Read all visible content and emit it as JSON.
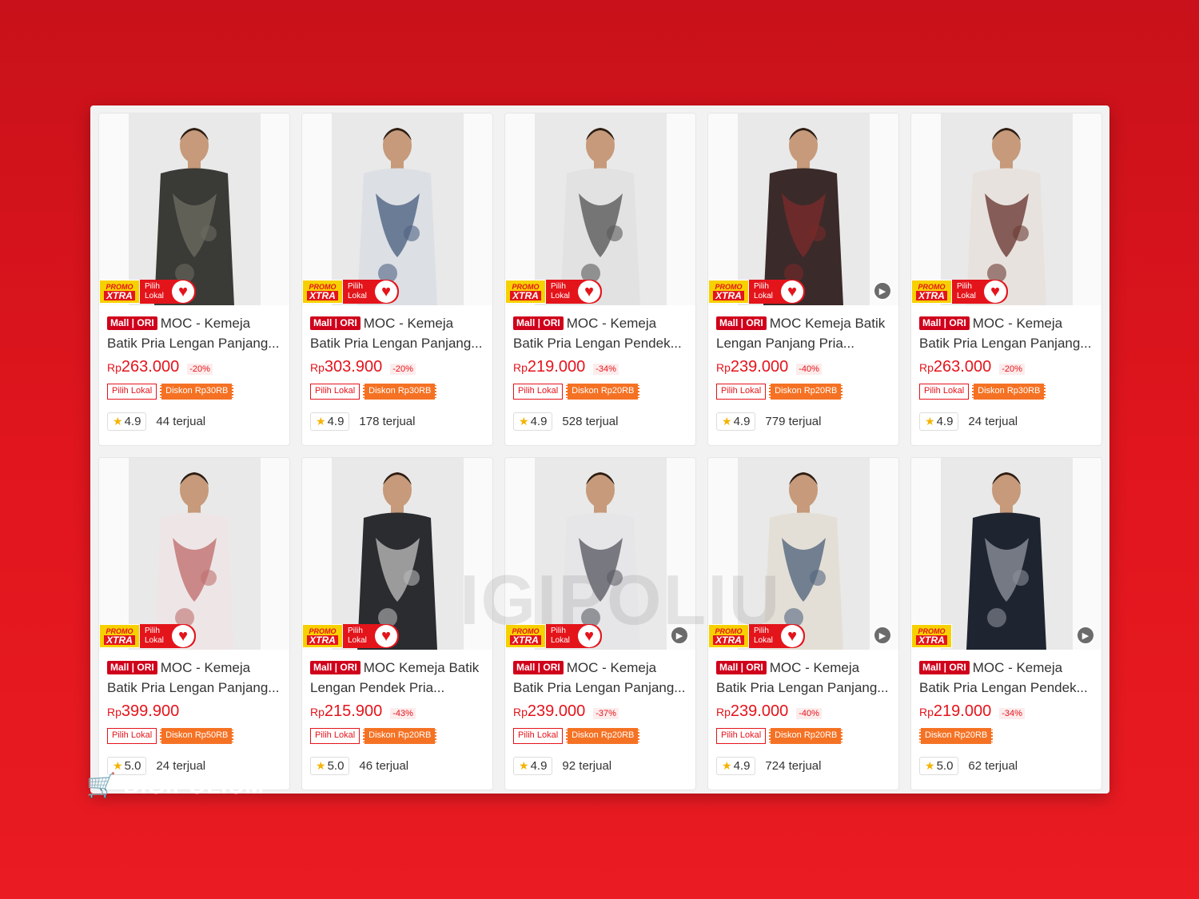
{
  "badges": {
    "promo_top": "PROMO",
    "promo_bottom": "XTRA",
    "pilih_line1": "Pilih",
    "pilih_line2": "Lokal",
    "mall": "Mall | ORI",
    "currency": "Rp"
  },
  "brand": {
    "name": "DIGIPOLIUM"
  },
  "watermark": {
    "text": "IGIPOLIU"
  },
  "products": [
    {
      "title": "MOC - Kemeja Batik Pria Lengan Panjang...",
      "price": "263.000",
      "discount": "-20%",
      "tag_outline": "Pilih Lokal",
      "tag_fill": "Diskon Rp30RB",
      "rating": "4.9",
      "sold": "44 terjual",
      "shirt_color": "#3a3a36",
      "pattern_color": "#6b6a60",
      "pilih": true,
      "video": false
    },
    {
      "title": "MOC - Kemeja Batik Pria Lengan Panjang...",
      "price": "303.900",
      "discount": "-20%",
      "tag_outline": "Pilih Lokal",
      "tag_fill": "Diskon Rp30RB",
      "rating": "4.9",
      "sold": "178 terjual",
      "shirt_color": "#dcdfe4",
      "pattern_color": "#4f6382",
      "pilih": true,
      "video": false
    },
    {
      "title": "MOC - Kemeja Batik Pria Lengan Pendek...",
      "price": "219.000",
      "discount": "-34%",
      "tag_outline": "Pilih Lokal",
      "tag_fill": "Diskon Rp20RB",
      "rating": "4.9",
      "sold": "528 terjual",
      "shirt_color": "#e2e2e2",
      "pattern_color": "#5a5a5a",
      "pilih": true,
      "video": false
    },
    {
      "title": "MOC Kemeja Batik Lengan Panjang Pria...",
      "price": "239.000",
      "discount": "-40%",
      "tag_outline": "Pilih Lokal",
      "tag_fill": "Diskon Rp20RB",
      "rating": "4.9",
      "sold": "779 terjual",
      "shirt_color": "#3b2a2a",
      "pattern_color": "#7a2a2a",
      "pilih": true,
      "video": true
    },
    {
      "title": "MOC - Kemeja Batik Pria Lengan Panjang...",
      "price": "263.000",
      "discount": "-20%",
      "tag_outline": "Pilih Lokal",
      "tag_fill": "Diskon Rp30RB",
      "rating": "4.9",
      "sold": "24 terjual",
      "shirt_color": "#e8e2de",
      "pattern_color": "#6b3b34",
      "pilih": true,
      "video": false
    },
    {
      "title": "MOC - Kemeja Batik Pria Lengan Panjang...",
      "price": "399.900",
      "discount": "",
      "tag_outline": "Pilih Lokal",
      "tag_fill": "Diskon Rp50RB",
      "rating": "5.0",
      "sold": "24 terjual",
      "shirt_color": "#eee6e6",
      "pattern_color": "#c07070",
      "pilih": true,
      "video": false
    },
    {
      "title": "MOC Kemeja Batik Lengan Pendek Pria...",
      "price": "215.900",
      "discount": "-43%",
      "tag_outline": "Pilih Lokal",
      "tag_fill": "Diskon Rp20RB",
      "rating": "5.0",
      "sold": "46 terjual",
      "shirt_color": "#2a2c30",
      "pattern_color": "#b8b8b8",
      "pilih": true,
      "video": false
    },
    {
      "title": "MOC - Kemeja Batik Pria Lengan Panjang...",
      "price": "239.000",
      "discount": "-37%",
      "tag_outline": "Pilih Lokal",
      "tag_fill": "Diskon Rp20RB",
      "rating": "4.9",
      "sold": "92 terjual",
      "shirt_color": "#e6e6e8",
      "pattern_color": "#5c5c66",
      "pilih": true,
      "video": true
    },
    {
      "title": "MOC - Kemeja Batik Pria Lengan Panjang...",
      "price": "239.000",
      "discount": "-40%",
      "tag_outline": "Pilih Lokal",
      "tag_fill": "Diskon Rp20RB",
      "rating": "4.9",
      "sold": "724 terjual",
      "shirt_color": "#e4dfd6",
      "pattern_color": "#54667e",
      "pilih": true,
      "video": true
    },
    {
      "title": "MOC - Kemeja Batik Pria Lengan Pendek...",
      "price": "219.000",
      "discount": "-34%",
      "tag_outline": "",
      "tag_fill": "Diskon Rp20RB",
      "rating": "5.0",
      "sold": "62 terjual",
      "shirt_color": "#1f2530",
      "pattern_color": "#8a8f99",
      "pilih": false,
      "video": true
    }
  ]
}
